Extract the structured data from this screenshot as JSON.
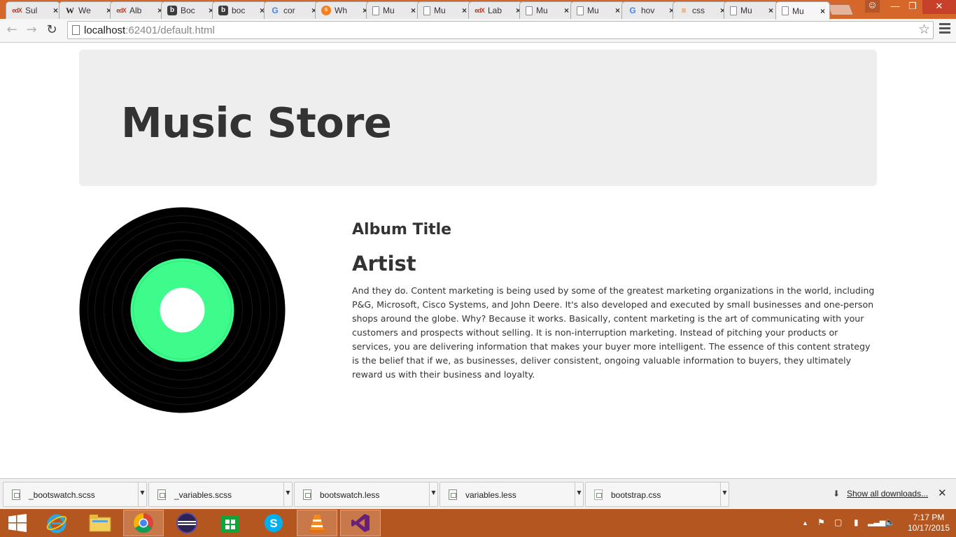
{
  "browser": {
    "tabs": [
      {
        "title": "Sul",
        "icon": "edx-favicon"
      },
      {
        "title": "We",
        "icon": "wikipedia-favicon"
      },
      {
        "title": "Alb",
        "icon": "edx-favicon"
      },
      {
        "title": "Boc",
        "icon": "bootswatch-favicon"
      },
      {
        "title": "boc",
        "icon": "bootswatch-favicon"
      },
      {
        "title": "cor",
        "icon": "google-favicon"
      },
      {
        "title": "Wh",
        "icon": "stack-favicon"
      },
      {
        "title": "Mu",
        "icon": "page-favicon"
      },
      {
        "title": "Mu",
        "icon": "page-favicon"
      },
      {
        "title": "Lab",
        "icon": "edx-favicon"
      },
      {
        "title": "Mu",
        "icon": "page-favicon"
      },
      {
        "title": "Mu",
        "icon": "page-favicon"
      },
      {
        "title": "hov",
        "icon": "google-favicon"
      },
      {
        "title": "css",
        "icon": "stackoverflow-favicon"
      },
      {
        "title": "Mu",
        "icon": "page-favicon"
      },
      {
        "title": "Mu",
        "icon": "page-favicon"
      }
    ],
    "active_tab_index": 15,
    "url_host": "localhost",
    "url_rest": ":62401/default.html"
  },
  "page": {
    "title": "Music Store",
    "album_title": "Album Title",
    "artist": "Artist",
    "description": "And they do. Content marketing is being used by some of the greatest marketing organizations in the world, including P&G, Microsoft, Cisco Systems, and John Deere. It's also developed and executed by small businesses and one-person shops around the globe. Why? Because it works. Basically, content marketing is the art of communicating with your customers and prospects without selling. It is non-interruption marketing. Instead of pitching your products or services, you are delivering information that makes your buyer more intelligent. The essence of this content strategy is the belief that if we, as businesses, deliver consistent, ongoing valuable information to buyers, they ultimately reward us with their business and loyalty.",
    "vinyl_label_color": "#3dfc8c"
  },
  "downloads": {
    "items": [
      "_bootswatch.scss",
      "_variables.scss",
      "bootswatch.less",
      "variables.less",
      "bootstrap.css"
    ],
    "show_all": "Show all downloads..."
  },
  "taskbar": {
    "apps": [
      "start-icon",
      "internet-explorer-icon",
      "file-explorer-icon",
      "chrome-icon",
      "eclipse-icon",
      "store-icon",
      "skype-icon",
      "vlc-icon",
      "visual-studio-icon"
    ],
    "time": "7:17 PM",
    "date": "10/17/2015"
  },
  "colors": {
    "accent": "#d6672a",
    "taskbar": "#b4561f",
    "jumbotron": "#eeeeee"
  }
}
